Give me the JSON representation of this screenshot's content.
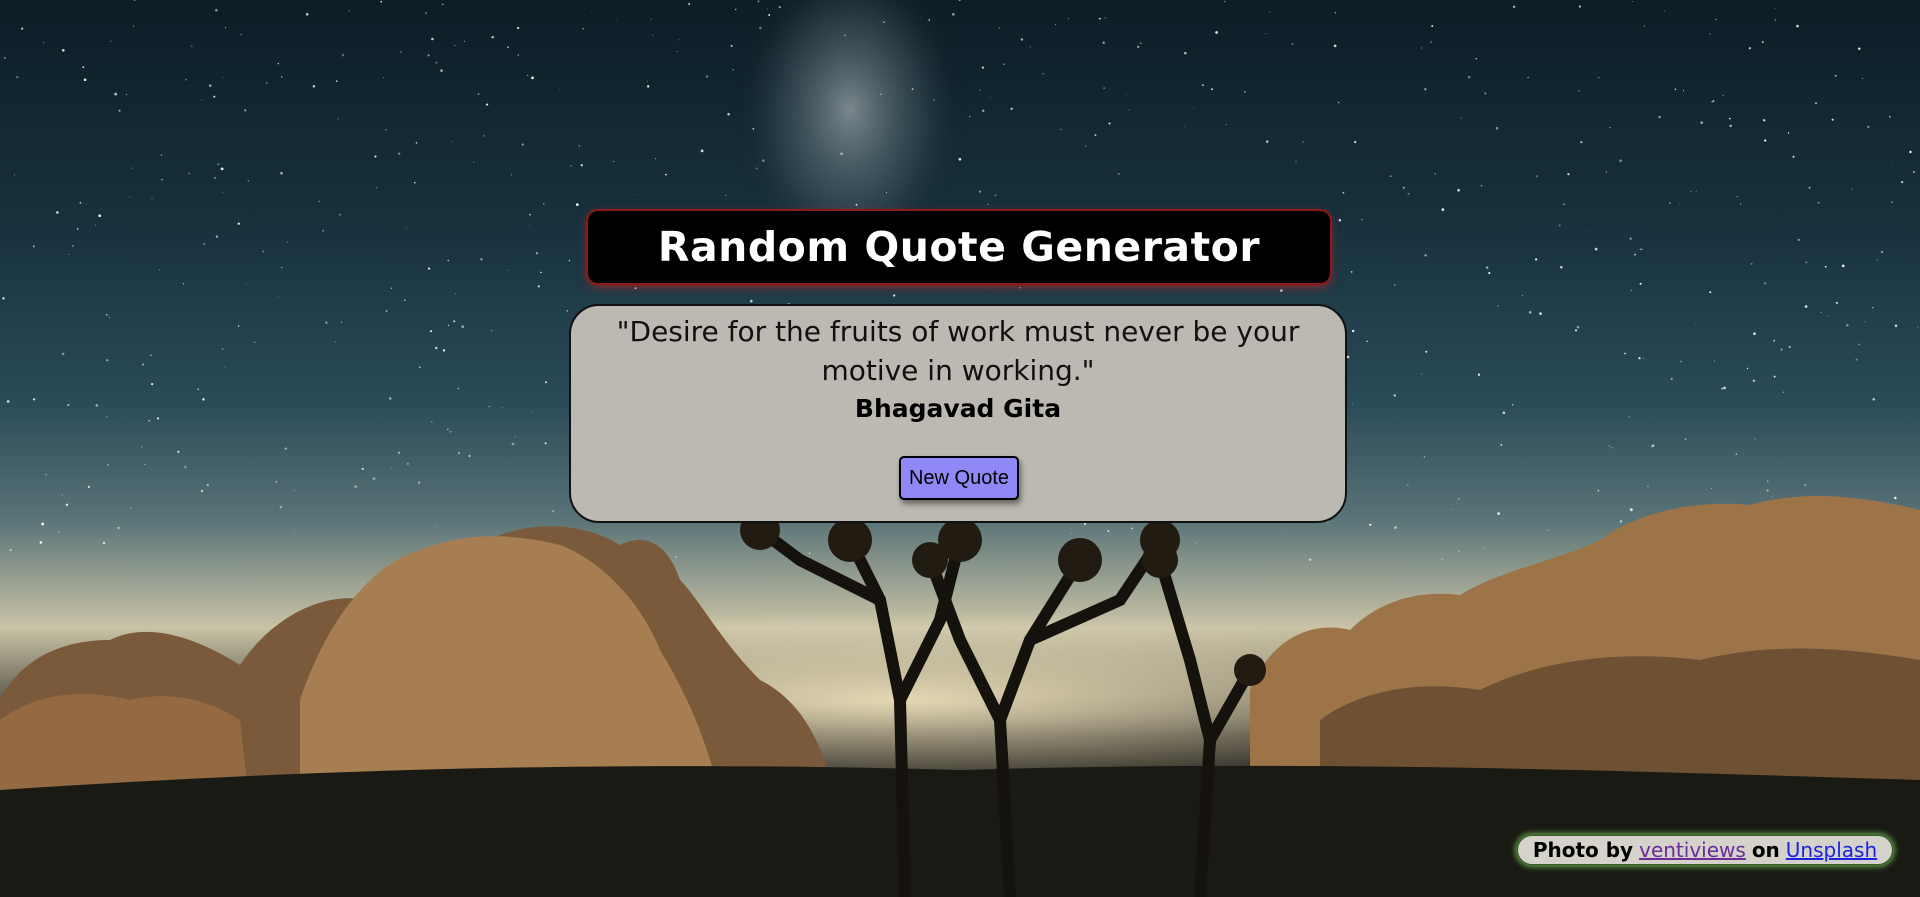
{
  "header": {
    "title": "Random Quote Generator"
  },
  "quote": {
    "text": "\"Desire for the fruits of work must never be your motive in working.\"",
    "author": "Bhagavad Gita",
    "button_label": "New Quote"
  },
  "credit": {
    "prefix": "Photo by",
    "photographer": "ventiviews",
    "middle": "on",
    "site": "Unsplash"
  },
  "colors": {
    "title_bg": "#000000",
    "title_glow": "#c81e1e",
    "card_bg": "#bcb8b2",
    "button_bg": "#8f88f6",
    "credit_glow": "#78c85a"
  }
}
